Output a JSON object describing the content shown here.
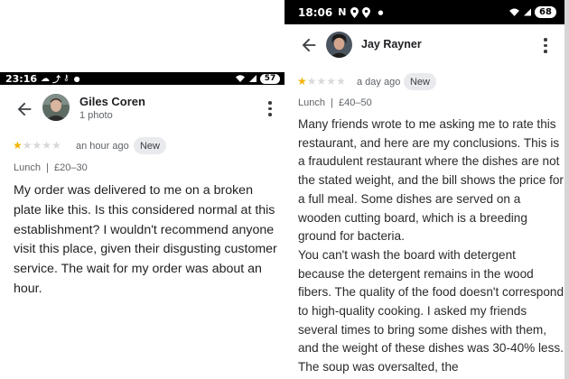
{
  "left": {
    "status": {
      "time": "23:16",
      "left_icons": [
        "cloud-icon",
        "trending-icon",
        "key-icon",
        "dot-icon"
      ],
      "right_icons": [
        "wifi-icon",
        "signal-icon"
      ],
      "battery": "57"
    },
    "reviewer": {
      "name": "Giles Coren",
      "subtitle": "1 photo",
      "avatar": "avatar-icon"
    },
    "rating": {
      "stars": 1,
      "max": 5
    },
    "time_ago": "an hour ago",
    "badge": "New",
    "meta": "Lunch  |  £20–30",
    "body": "My order was delivered to me on a broken plate like this. Is this considered normal at this establishment? I wouldn't recommend anyone visit this place, given their disgusting customer service. The wait for my order was about an hour."
  },
  "right": {
    "status": {
      "time": "18:06",
      "left_icons": [
        "n-icon",
        "location-icon",
        "location-icon",
        "dot-icon"
      ],
      "right_icons": [
        "wifi-icon",
        "signal-icon"
      ],
      "battery": "68"
    },
    "reviewer": {
      "name": "Jay Rayner",
      "avatar": "avatar-icon"
    },
    "rating": {
      "stars": 1,
      "max": 5
    },
    "time_ago": "a day ago",
    "badge": "New",
    "meta": "Lunch  |  £40–50",
    "body": "Many friends wrote to me asking me to rate this restaurant, and here are my conclusions. This is a fraudulent restaurant where the dishes are not the stated weight, and the bill shows the price for a full meal. Some dishes are served on a wooden cutting board, which is a breeding ground for bacteria.\nYou can't wash the board with detergent because the detergent remains in the wood fibers. The quality of the food doesn't correspond to high-quality cooking. I asked my friends several times to bring some dishes with them, and the weight of these dishes was 30-40% less. The soup was oversalted, the"
  },
  "colors": {
    "star_filled": "#f4b400",
    "star_empty": "#d9d9d9",
    "badge_bg": "#e8eaed"
  }
}
